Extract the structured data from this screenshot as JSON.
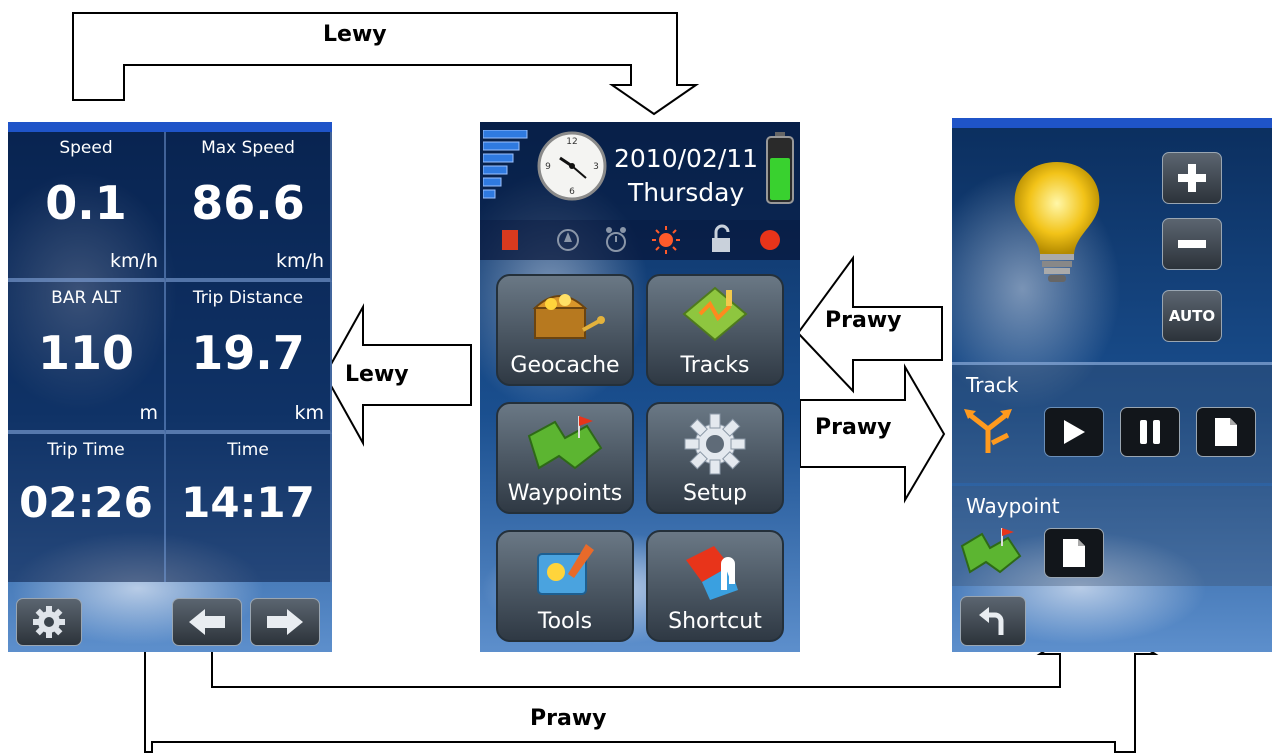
{
  "annotations": {
    "top": "Lewy",
    "middle_left": "Lewy",
    "right_upper": "Prawy",
    "right_lower": "Prawy",
    "bottom": "Prawy"
  },
  "dashboard": {
    "cells": [
      {
        "label": "Speed",
        "value": "0.1",
        "unit": "km/h"
      },
      {
        "label": "Max Speed",
        "value": "86.6",
        "unit": "km/h"
      },
      {
        "label": "BAR ALT",
        "value": "110",
        "unit": "m"
      },
      {
        "label": "Trip Distance",
        "value": "19.7",
        "unit": "km"
      },
      {
        "label": "Trip Time",
        "value": "02:26",
        "unit": ""
      },
      {
        "label": "Time",
        "value": "14:17",
        "unit": ""
      }
    ]
  },
  "main_menu": {
    "date": "2010/02/11",
    "weekday": "Thursday",
    "tiles": [
      {
        "label": "Geocache",
        "icon": "treasure-chest-icon"
      },
      {
        "label": "Tracks",
        "icon": "tracks-icon"
      },
      {
        "label": "Waypoints",
        "icon": "waypoints-map-icon"
      },
      {
        "label": "Setup",
        "icon": "gear-icon"
      },
      {
        "label": "Tools",
        "icon": "tools-icon"
      },
      {
        "label": "Shortcut",
        "icon": "shortcut-icon"
      }
    ]
  },
  "control": {
    "auto_label": "AUTO",
    "track_title": "Track",
    "waypoint_title": "Waypoint"
  },
  "colors": {
    "screen_top": "#0b2e5e",
    "screen_bottom": "#5d8fcc",
    "accent_bar": "#1f54c8",
    "battery": "#39d12f"
  }
}
